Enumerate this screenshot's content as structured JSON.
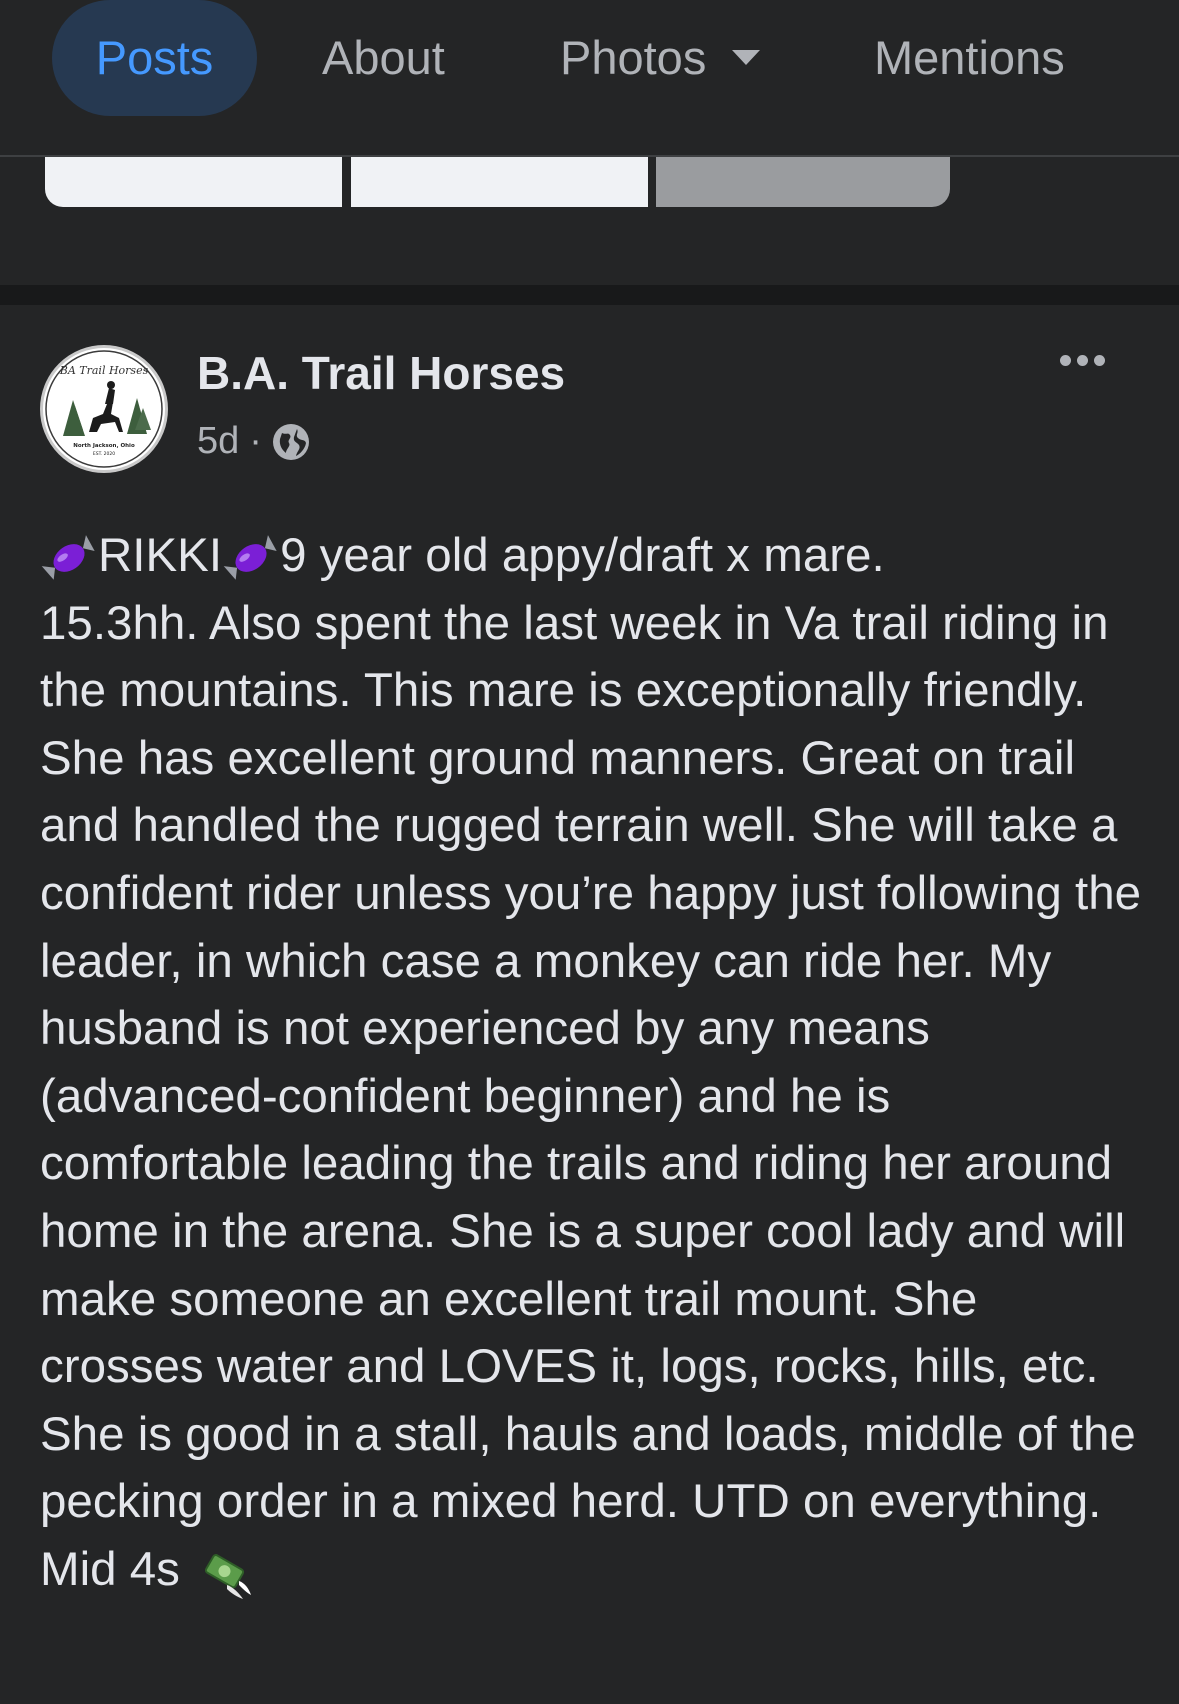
{
  "tabs": [
    {
      "label": "Posts",
      "active": true
    },
    {
      "label": "About",
      "active": false
    },
    {
      "label": "Photos",
      "active": false,
      "has_dropdown": true
    },
    {
      "label": "Mentions",
      "active": false
    }
  ],
  "colors": {
    "background": "#242526",
    "active_tab_bg": "#263951",
    "active_tab_text": "#4599ff",
    "text_primary": "#e4e6eb",
    "text_secondary": "#b0b3b8"
  },
  "post": {
    "author": "B.A. Trail Horses",
    "time": "5d",
    "separator": "·",
    "audience_icon": "globe-icon",
    "menu_icon": "more-options-icon",
    "avatar_logo_text": "BA Trail Horses",
    "avatar_location_text": "North Jackson, Ohio",
    "avatar_est_text": "EST. 2020",
    "body_name": "RIKKI",
    "body_intro": "9 year old appy/draft x mare.",
    "body_main": "15.3hh. Also spent the last week in Va trail riding in the mountains. This mare is exceptionally friendly. She has excellent ground manners. Great on trail and handled the rugged terrain well. She will take a confident rider unless you’re happy just following the leader, in which case a monkey can ride her. My husband is not experienced by any means (advanced-confident beginner) and he is comfortable leading the trails and riding her around home in the arena. She is a super cool lady and will make someone an excellent trail mount. She crosses water and LOVES it, logs, rocks, hills, etc. She is good in a stall, hauls and loads, middle of the pecking order in a mixed herd. UTD on everything. Mid 4s",
    "emoji_candy": "candy-icon",
    "emoji_money": "money-with-wings-icon"
  }
}
